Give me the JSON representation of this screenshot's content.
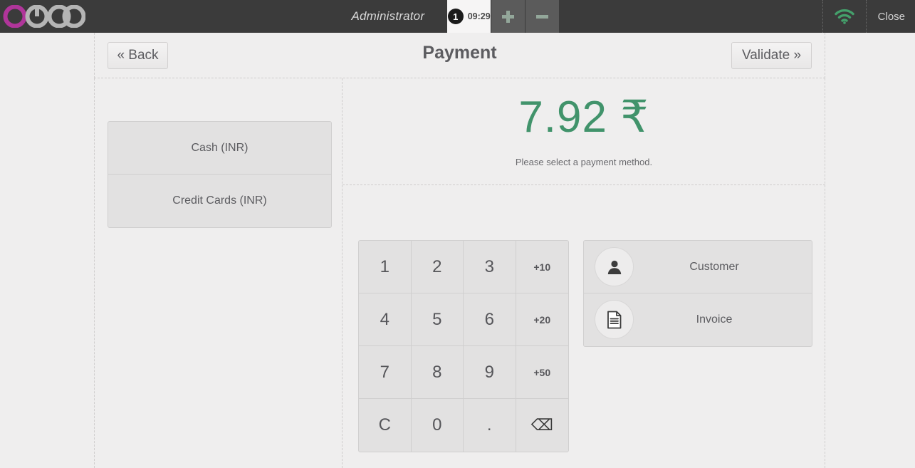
{
  "topbar": {
    "logo_text": "odoo",
    "logo_accent_color": "#b0359a",
    "logo_gray_color": "#b5b5b5",
    "username": "Administrator",
    "order_tab": {
      "badge": "1",
      "time": "09:29"
    },
    "add_order_label": "+",
    "remove_order_label": "−",
    "add_order_icon": "plus-icon",
    "remove_order_icon": "minus-icon",
    "wifi_icon": "wifi-icon",
    "wifi_color": "#44a06b",
    "close_label": "Close"
  },
  "header": {
    "back_label": "« Back",
    "title": "Payment",
    "validate_label": "Validate »"
  },
  "payment_methods": [
    {
      "label": "Cash (INR)"
    },
    {
      "label": "Credit Cards (INR)"
    }
  ],
  "amount": {
    "value": "7.92 ₹",
    "color": "#41936b",
    "hint": "Please select a payment method."
  },
  "numpad": {
    "keys": [
      {
        "label": "1",
        "kind": "digit",
        "name": "numpad-key-1"
      },
      {
        "label": "2",
        "kind": "digit",
        "name": "numpad-key-2"
      },
      {
        "label": "3",
        "kind": "digit",
        "name": "numpad-key-3"
      },
      {
        "label": "+10",
        "kind": "small",
        "name": "numpad-key-plus-10"
      },
      {
        "label": "4",
        "kind": "digit",
        "name": "numpad-key-4"
      },
      {
        "label": "5",
        "kind": "digit",
        "name": "numpad-key-5"
      },
      {
        "label": "6",
        "kind": "digit",
        "name": "numpad-key-6"
      },
      {
        "label": "+20",
        "kind": "small",
        "name": "numpad-key-plus-20"
      },
      {
        "label": "7",
        "kind": "digit",
        "name": "numpad-key-7"
      },
      {
        "label": "8",
        "kind": "digit",
        "name": "numpad-key-8"
      },
      {
        "label": "9",
        "kind": "digit",
        "name": "numpad-key-9"
      },
      {
        "label": "+50",
        "kind": "small",
        "name": "numpad-key-plus-50"
      },
      {
        "label": "C",
        "kind": "digit",
        "name": "numpad-key-clear"
      },
      {
        "label": "0",
        "kind": "digit",
        "name": "numpad-key-0"
      },
      {
        "label": ".",
        "kind": "digit",
        "name": "numpad-key-decimal"
      },
      {
        "label": "⌫",
        "kind": "backspace",
        "name": "numpad-key-backspace"
      }
    ]
  },
  "side_actions": [
    {
      "label": "Customer",
      "icon": "user-icon"
    },
    {
      "label": "Invoice",
      "icon": "document-icon"
    }
  ]
}
